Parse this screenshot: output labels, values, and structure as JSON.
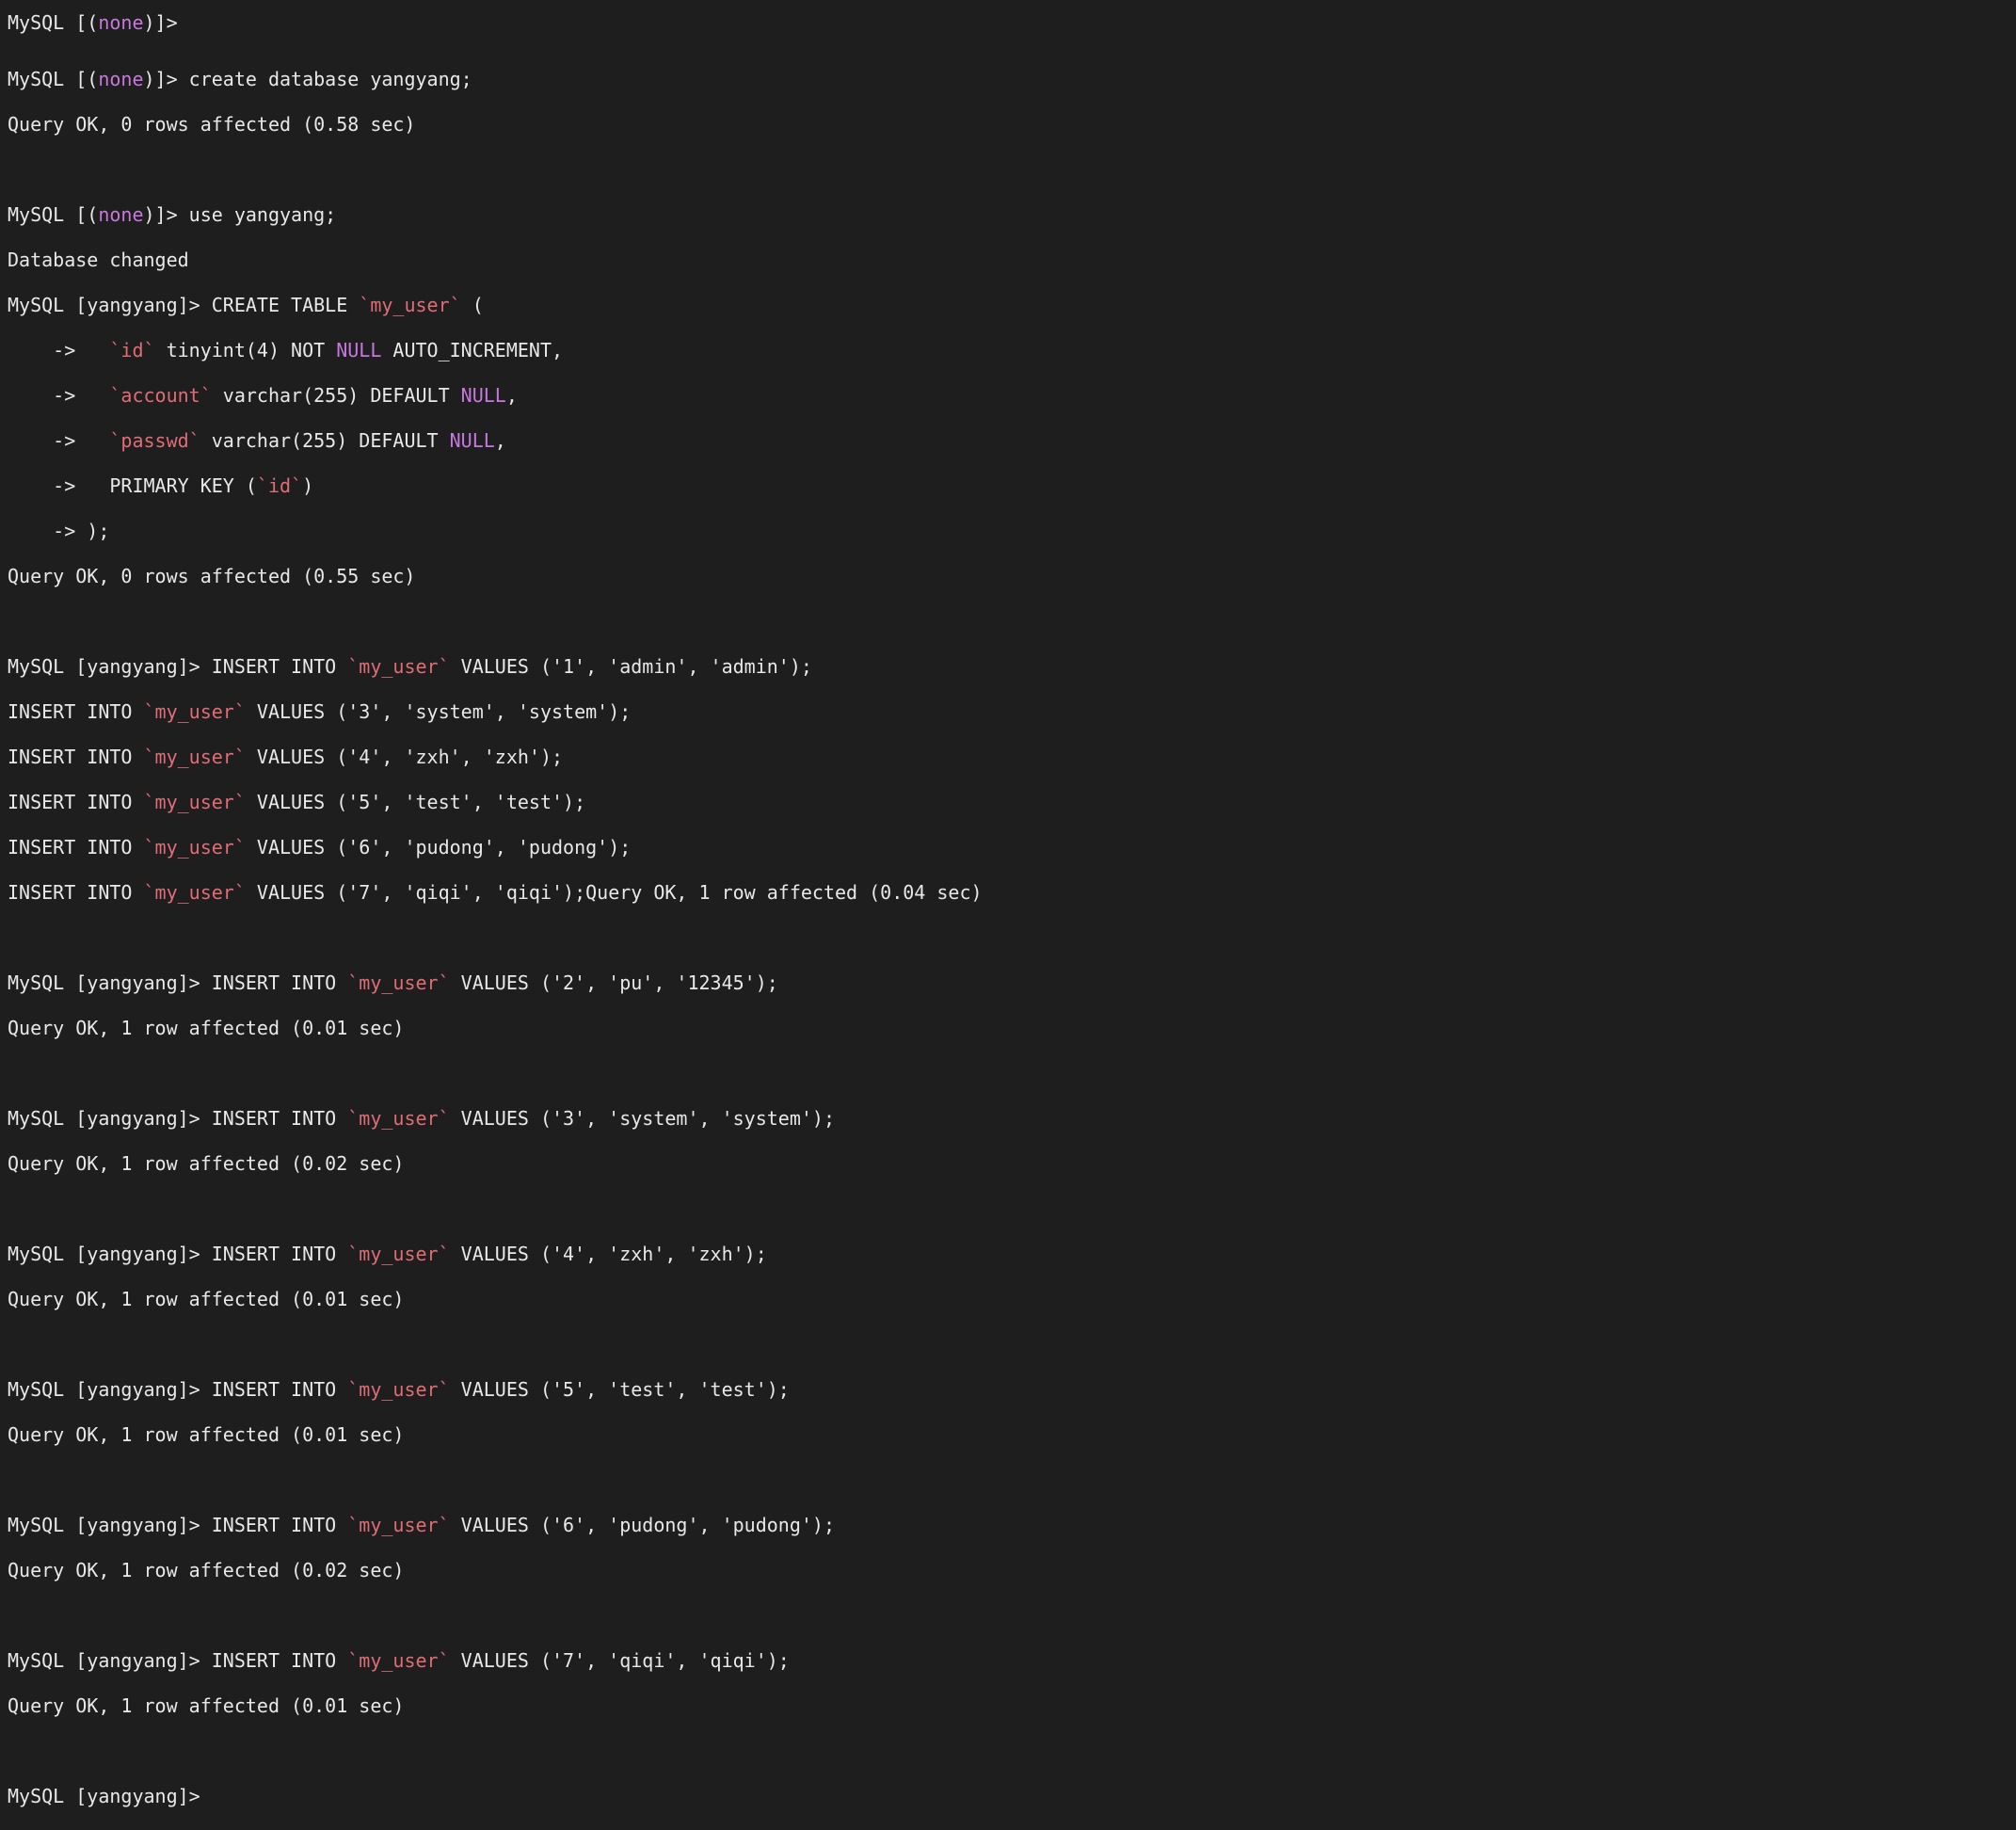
{
  "colors": {
    "bg": "#1e1e1e",
    "fg": "#e8e8e8",
    "magenta": "#c678dd",
    "orange": "#e06c75"
  },
  "prompts": {
    "none": "MySQL [(none)]>",
    "db": "MySQL [yangyang]>"
  },
  "continuation": "    ->   ",
  "tokens": {
    "none": "none",
    "null": "NULL",
    "my_user": "`my_user`",
    "id": "`id`",
    "account": "`account`",
    "passwd": "`passwd`"
  },
  "lines": {
    "l0a": "MySQL [(",
    "l0b": ")]>",
    "l1a": "MySQL [(",
    "l1b": ")]> create database yangyang;",
    "l2": "Query OK, 0 rows affected (0.58 sec)",
    "l3": "",
    "l4a": "MySQL [(",
    "l4b": ")]> use yangyang;",
    "l5": "Database changed",
    "l6a": "MySQL [yangyang]> CREATE TABLE ",
    "l6b": " (",
    "l7a": "    ->   ",
    "l7b": " tinyint(4) NOT ",
    "l7c": " AUTO_INCREMENT,",
    "l8a": "    ->   ",
    "l8b": " varchar(255) DEFAULT ",
    "l8c": ",",
    "l9a": "    ->   ",
    "l9b": " varchar(255) DEFAULT ",
    "l9c": ",",
    "l10a": "    ->   PRIMARY KEY (",
    "l10b": ")",
    "l11": "    -> );",
    "l12": "Query OK, 0 rows affected (0.55 sec)",
    "l13": "",
    "l14a": "MySQL [yangyang]> INSERT INTO ",
    "l14b": " VALUES ('1', 'admin', 'admin');",
    "l15a": "INSERT INTO ",
    "l15b": " VALUES ('3', 'system', 'system');",
    "l16a": "INSERT INTO ",
    "l16b": " VALUES ('4', 'zxh', 'zxh');",
    "l17a": "INSERT INTO ",
    "l17b": " VALUES ('5', 'test', 'test');",
    "l18a": "INSERT INTO ",
    "l18b": " VALUES ('6', 'pudong', 'pudong');",
    "l19a": "INSERT INTO ",
    "l19b": " VALUES ('7', 'qiqi', 'qiqi');Query OK, 1 row affected (0.04 sec)",
    "l20": "",
    "l21a": "MySQL [yangyang]> INSERT INTO ",
    "l21b": " VALUES ('2', 'pu', '12345');",
    "l22": "Query OK, 1 row affected (0.01 sec)",
    "l23": "",
    "l24a": "MySQL [yangyang]> INSERT INTO ",
    "l24b": " VALUES ('3', 'system', 'system');",
    "l25": "Query OK, 1 row affected (0.02 sec)",
    "l26": "",
    "l27a": "MySQL [yangyang]> INSERT INTO ",
    "l27b": " VALUES ('4', 'zxh', 'zxh');",
    "l28": "Query OK, 1 row affected (0.01 sec)",
    "l29": "",
    "l30a": "MySQL [yangyang]> INSERT INTO ",
    "l30b": " VALUES ('5', 'test', 'test');",
    "l31": "Query OK, 1 row affected (0.01 sec)",
    "l32": "",
    "l33a": "MySQL [yangyang]> INSERT INTO ",
    "l33b": " VALUES ('6', 'pudong', 'pudong');",
    "l34": "Query OK, 1 row affected (0.02 sec)",
    "l35": "",
    "l36a": "MySQL [yangyang]> INSERT INTO ",
    "l36b": " VALUES ('7', 'qiqi', 'qiqi');",
    "l37": "Query OK, 1 row affected (0.01 sec)",
    "l38": "",
    "l39": "MySQL [yangyang]>"
  },
  "inserts": [
    {
      "id": "1",
      "account": "admin",
      "passwd": "admin"
    },
    {
      "id": "2",
      "account": "pu",
      "passwd": "12345"
    },
    {
      "id": "3",
      "account": "system",
      "passwd": "system"
    },
    {
      "id": "4",
      "account": "zxh",
      "passwd": "zxh"
    },
    {
      "id": "5",
      "account": "test",
      "passwd": "test"
    },
    {
      "id": "6",
      "account": "pudong",
      "passwd": "pudong"
    },
    {
      "id": "7",
      "account": "qiqi",
      "passwd": "qiqi"
    }
  ]
}
